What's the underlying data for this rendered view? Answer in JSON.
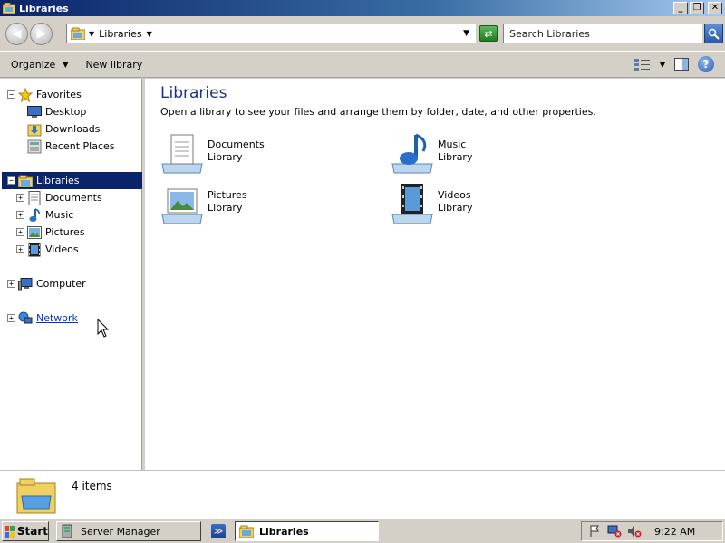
{
  "window": {
    "title": "Libraries"
  },
  "address": {
    "path": "Libraries",
    "search_placeholder": "Search Libraries"
  },
  "commandbar": {
    "organize": "Organize",
    "new_library": "New library",
    "help": "?"
  },
  "nav": {
    "favorites": "Favorites",
    "favorites_items": [
      "Desktop",
      "Downloads",
      "Recent Places"
    ],
    "libraries": "Libraries",
    "libraries_items": [
      "Documents",
      "Music",
      "Pictures",
      "Videos"
    ],
    "computer": "Computer",
    "network": "Network"
  },
  "content": {
    "heading": "Libraries",
    "description": "Open a library to see your files and arrange them by folder, date, and other properties.",
    "libraries": [
      {
        "name": "Documents",
        "type": "Library",
        "icon": "documents-library-icon"
      },
      {
        "name": "Music",
        "type": "Library",
        "icon": "music-library-icon"
      },
      {
        "name": "Pictures",
        "type": "Library",
        "icon": "pictures-library-icon"
      },
      {
        "name": "Videos",
        "type": "Library",
        "icon": "videos-library-icon"
      }
    ]
  },
  "details": {
    "count": "4 items"
  },
  "taskbar": {
    "start": "Start",
    "tasks": [
      "Server Manager",
      "Libraries"
    ],
    "clock": "9:22 AM"
  },
  "colors": {
    "title_start": "#0a246a",
    "selection": "#0a246a",
    "heading": "#1e3287",
    "link": "#0033cc"
  }
}
